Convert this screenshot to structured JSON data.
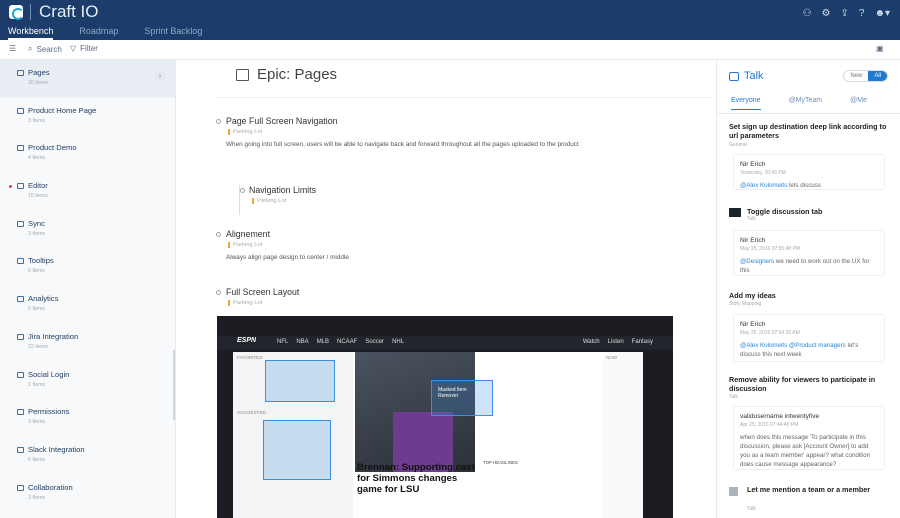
{
  "app": {
    "title": "Craft IO",
    "tabs": [
      "Workbench",
      "Roadmap",
      "Sprint Backlog"
    ]
  },
  "toolbar": {
    "search": "Search",
    "filter": "Filter"
  },
  "sidebar": {
    "items": [
      {
        "label": "Pages",
        "count": "20 Items",
        "active": true
      },
      {
        "label": "Product Home Page",
        "count": "3 Items"
      },
      {
        "label": "Product Demo",
        "count": "4 Items"
      },
      {
        "label": "Editor",
        "count": "10 Items",
        "dot": true
      },
      {
        "label": "Sync",
        "count": "3 Items"
      },
      {
        "label": "Tooltips",
        "count": "6 Items"
      },
      {
        "label": "Analytics",
        "count": "5 Items"
      },
      {
        "label": "Jira Integration",
        "count": "22 Items"
      },
      {
        "label": "Social Login",
        "count": "1 Items"
      },
      {
        "label": "Permissions",
        "count": "3 Items"
      },
      {
        "label": "Slack Integration",
        "count": "6 Items"
      },
      {
        "label": "Collaboration",
        "count": "3 Items"
      }
    ]
  },
  "main": {
    "epic_title": "Epic: Pages",
    "nodes": [
      {
        "title": "Page Full Screen Navigation",
        "tag": "Parking Lot",
        "desc": "When going into full screen, users will be able to navigate back and forward throughout all the pages uploaded to the product"
      },
      {
        "title": "Navigation Limits",
        "tag": "Parking Lot"
      },
      {
        "title": "Alignement",
        "tag": "Parking Lot",
        "desc": "Always align page design to center / middle"
      },
      {
        "title": "Full Screen Layout",
        "tag": "Parking Lot"
      }
    ],
    "screenshot": {
      "nav": [
        "NFL",
        "NBA",
        "MLB",
        "NCAAF",
        "Soccer",
        "NHL"
      ],
      "nav_right": [
        "Watch",
        "Listen",
        "Fantasy"
      ],
      "logo": "ESPN",
      "headline": "Brennan: Supporting cast for Simmons changes game for LSU",
      "top_headlines": "TOP HEADLINES",
      "now": "NOW",
      "favorites": "FAVORITES",
      "suggested": "SUGGESTED",
      "masked": "Masked Item Remover"
    }
  },
  "talk": {
    "title": "Talk",
    "toggle": [
      "New",
      "All"
    ],
    "tabs": [
      "Everyone",
      "@MyTeam",
      "@Me"
    ],
    "threads": [
      {
        "title": "Set sign up destination deep link according to url parameters",
        "sub": "General",
        "author": "Nir Erich",
        "time": "Yesterday, 20:45 PM",
        "mention": "@Alex Kolomeits",
        "text": " lets discuss"
      },
      {
        "title": "Toggle discussion tab",
        "sub": "Talk",
        "author": "Nir Erich",
        "time": "May 25, 2016 07:55:48 PM",
        "mention": "@Designers",
        "text": " we need to work out on the UX for this"
      },
      {
        "title": "Add my ideas",
        "sub": "Story Mapping",
        "author": "Nir Erich",
        "time": "May 25, 2016 07:54:26 AM",
        "mention": "@Alex Kolomeits @Product managers",
        "text": " let's discuss this next week"
      },
      {
        "title": "Remove ability for viewers to participate in discussion",
        "sub": "Talk",
        "author": "validusername intwentyfive",
        "time": "Apr 25, 2016 07:44:40 PM",
        "text": "when does this message 'To participate in this discussion, please ask [Account Owner] to add you as a team member' appear? what condition does cause message appearance?"
      },
      {
        "title": "Let me mention a team or a member",
        "sub": "Talk"
      }
    ]
  }
}
